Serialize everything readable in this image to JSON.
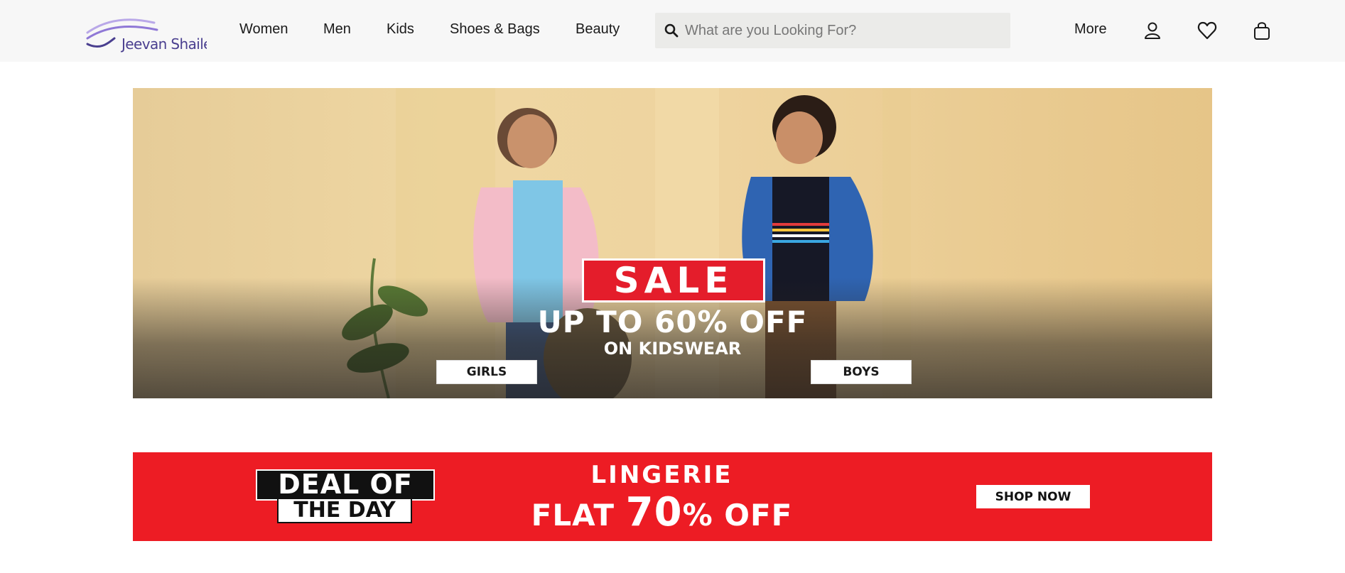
{
  "header": {
    "brand": "Jeevan Shailee",
    "nav": [
      "Women",
      "Men",
      "Kids",
      "Shoes & Bags",
      "Beauty"
    ],
    "search": {
      "placeholder": "What are you Looking For?",
      "icon": "search-icon"
    },
    "more_label": "More",
    "icons": [
      "user-icon",
      "heart-icon",
      "shopping-bag-icon"
    ]
  },
  "hero": {
    "badge": "SALE",
    "headline": "UP TO 60% OFF",
    "subline": "ON KIDSWEAR",
    "buttons": [
      "GIRLS",
      "BOYS"
    ],
    "colors": {
      "badge": "#e41d2b"
    }
  },
  "deal": {
    "badge_line1": "DEAL OF",
    "badge_line2": "THE DAY",
    "title": "LINGERIE",
    "offer_prefix": "FLAT",
    "offer_value": "70",
    "offer_suffix": "% OFF",
    "cta": "SHOP NOW",
    "colors": {
      "background": "#ed1c24"
    }
  }
}
